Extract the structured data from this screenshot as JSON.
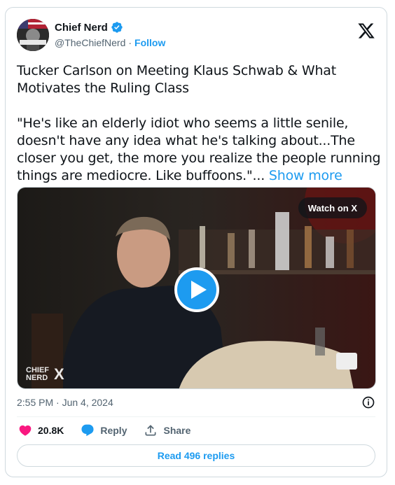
{
  "author": {
    "name": "Chief Nerd",
    "handle": "@TheChiefNerd",
    "separator": "·",
    "follow_label": "Follow",
    "avatar_text": "CHIEF NERD"
  },
  "tweet": {
    "title_line": "Tucker Carlson on Meeting Klaus Schwab & What Motivates the Ruling Class",
    "quote": "\"He's like an elderly idiot who seems a little senile, doesn't have any idea what he's talking about...The closer you get, the more you realize the people running things are mediocre. Like buffoons.\"...",
    "show_more_label": "Show more"
  },
  "media": {
    "watch_label": "Watch on X",
    "watermark_line1": "CHIEF",
    "watermark_line2": "NERD",
    "watermark_x": "X"
  },
  "meta": {
    "timestamp": "2:55 PM · Jun 4, 2024"
  },
  "actions": {
    "like_count": "20.8K",
    "reply_label": "Reply",
    "share_label": "Share"
  },
  "replies": {
    "label": "Read 496 replies"
  },
  "colors": {
    "accent": "#1d9bf0",
    "like": "#f91880",
    "text": "#0f1419",
    "muted": "#536471"
  }
}
